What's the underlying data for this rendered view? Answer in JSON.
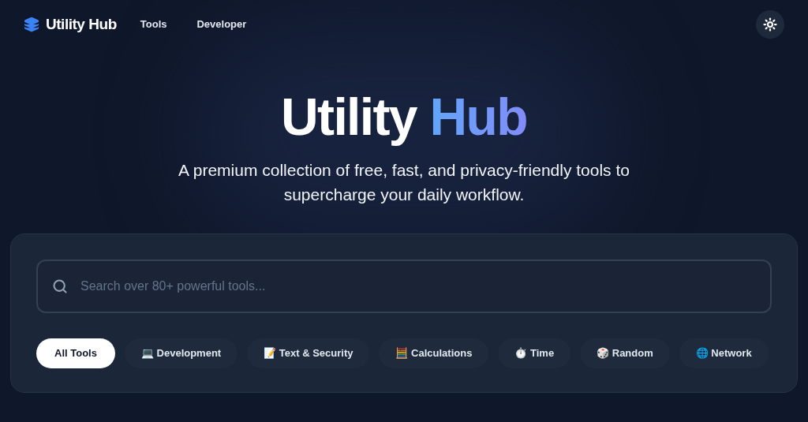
{
  "nav": {
    "brand": "Utility Hub",
    "links": [
      {
        "label": "Tools"
      },
      {
        "label": "Developer"
      }
    ]
  },
  "hero": {
    "title_main": "Utility",
    "title_accent": "Hub",
    "subtitle": "A premium collection of free, fast, and privacy-friendly tools to supercharge your daily workflow."
  },
  "search": {
    "placeholder": "Search over 80+ powerful tools..."
  },
  "categories": [
    {
      "label": "All Tools",
      "selected": true
    },
    {
      "label": "💻 Development",
      "selected": false
    },
    {
      "label": "📝 Text & Security",
      "selected": false
    },
    {
      "label": "🧮 Calculations",
      "selected": false
    },
    {
      "label": "⏱️ Time",
      "selected": false
    },
    {
      "label": "🎲 Random",
      "selected": false
    },
    {
      "label": "🌐 Network",
      "selected": false
    }
  ]
}
